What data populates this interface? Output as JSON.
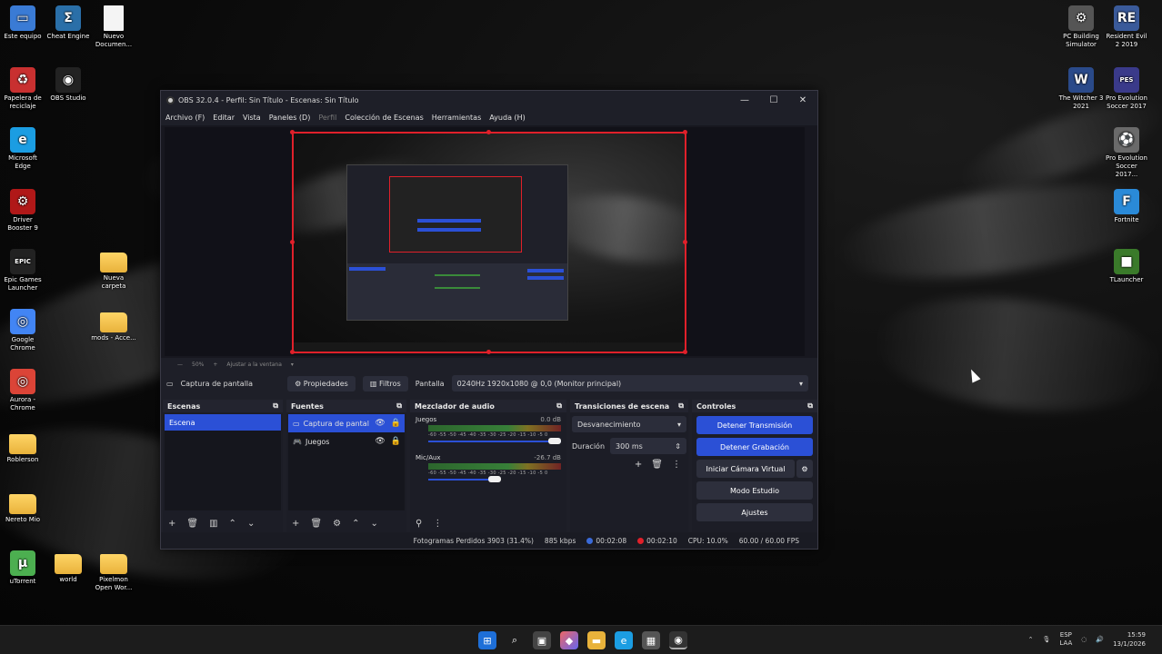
{
  "desktop": {
    "left_icons": [
      {
        "label": "Este equipo",
        "icon": "computer-icon",
        "color": "#3a7bd5"
      },
      {
        "label": "Cheat Engine",
        "icon": "cheat-engine-icon",
        "color": "#2a6fa8"
      },
      {
        "label": "Nuevo Documen...",
        "icon": "document-icon",
        "color": "#f4f4f4"
      },
      {
        "label": "Papelera de reciclaje",
        "icon": "recycle-bin-icon",
        "color": "#c83030"
      },
      {
        "label": "OBS Studio",
        "icon": "obs-icon",
        "color": "#222"
      },
      {
        "label": "Microsoft Edge",
        "icon": "edge-icon",
        "color": "#1b9de2"
      },
      {
        "label": "Driver Booster 9",
        "icon": "driver-booster-icon",
        "color": "#b01818"
      },
      {
        "label": "Epic Games Launcher",
        "icon": "epic-games-icon",
        "color": "#222"
      },
      {
        "label": "Nueva carpeta",
        "icon": "folder-icon",
        "color": "#ffd566"
      },
      {
        "label": "Google Chrome",
        "icon": "chrome-icon",
        "color": "#4285f4"
      },
      {
        "label": "mods - Acce...",
        "icon": "folder-icon",
        "color": "#ffd566"
      },
      {
        "label": "Aurora - Chrome",
        "icon": "chrome-icon",
        "color": "#db4437"
      },
      {
        "label": "Roblerson",
        "icon": "folder-icon",
        "color": "#ffd566"
      },
      {
        "label": "Nereto Mio",
        "icon": "folder-icon",
        "color": "#ffd566"
      },
      {
        "label": "uTorrent",
        "icon": "utorrent-icon",
        "color": "#4caf50"
      },
      {
        "label": "world",
        "icon": "folder-icon",
        "color": "#ffd566"
      },
      {
        "label": "Pixelmon Open Wor...",
        "icon": "folder-icon",
        "color": "#ffd566"
      }
    ],
    "right_icons": [
      {
        "label": "PC Building Simulator",
        "icon": "pc-building-icon",
        "color": "#555"
      },
      {
        "label": "Resident Evil 2 2019",
        "icon": "resident-evil-icon",
        "color": "#3a5a9a"
      },
      {
        "label": "The Witcher 3 2021",
        "icon": "witcher-icon",
        "color": "#2a4a8a"
      },
      {
        "label": "Pro Evolution Soccer 2017",
        "icon": "pes-2017-icon",
        "color": "#3a3a8a"
      },
      {
        "label": "Pro Evolution Soccer 2017...",
        "icon": "pes-icon",
        "color": "#6a6a6a"
      },
      {
        "label": "Fortnite",
        "icon": "fortnite-icon",
        "color": "#2a8ad8"
      },
      {
        "label": "TLauncher",
        "icon": "tlauncher-icon",
        "color": "#3a7a2a"
      }
    ]
  },
  "obs": {
    "title": "OBS 32.0.4 - Perfil: Sin Título - Escenas: Sin Título",
    "menu": [
      "Archivo (F)",
      "Editar",
      "Vista",
      "Paneles (D)",
      "Perfil",
      "Colección de Escenas",
      "Herramientas",
      "Ayuda (H)"
    ],
    "zoom": {
      "value": "50%",
      "fit": "Ajustar a la ventana"
    },
    "source_bar": {
      "name": "Captura de pantalla",
      "properties": "Propiedades",
      "filters": "Filtros",
      "screen_label": "Pantalla",
      "screen_value": "0240Hz 1920x1080 @ 0,0 (Monitor principal)"
    },
    "scenes": {
      "title": "Escenas",
      "items": [
        "Escena"
      ]
    },
    "sources": {
      "title": "Fuentes",
      "items": [
        "Captura de pantal",
        "Juegos"
      ]
    },
    "mixer": {
      "title": "Mezclador de audio",
      "ticks": "-60 -55 -50 -45 -40 -35 -30 -25 -20 -15 -10 -5 0",
      "channels": [
        {
          "name": "Juegos",
          "level": "0.0 dB",
          "volume": 1.0
        },
        {
          "name": "Mic/Aux",
          "level": "-26.7 dB",
          "volume": 0.5
        }
      ]
    },
    "transitions": {
      "title": "Transiciones de escena",
      "type": "Desvanecimiento",
      "duration_label": "Duración",
      "duration_value": "300 ms"
    },
    "controls": {
      "title": "Controles",
      "stop_stream": "Detener Transmisión",
      "stop_record": "Detener Grabación",
      "virtual_cam": "Iniciar Cámara Virtual",
      "studio_mode": "Modo Estudio",
      "settings": "Ajustes"
    },
    "status": {
      "dropped": "Fotogramas Perdidos 3903 (31.4%)",
      "bitrate": "885 kbps",
      "stream_time": "00:02:08",
      "rec_time": "00:02:10",
      "cpu": "CPU: 10.0%",
      "fps": "60.00 / 60.00 FPS"
    }
  },
  "taskbar": {
    "lang1": "ESP",
    "lang2": "LAA",
    "time": "15:59",
    "date": "13/1/2026"
  }
}
